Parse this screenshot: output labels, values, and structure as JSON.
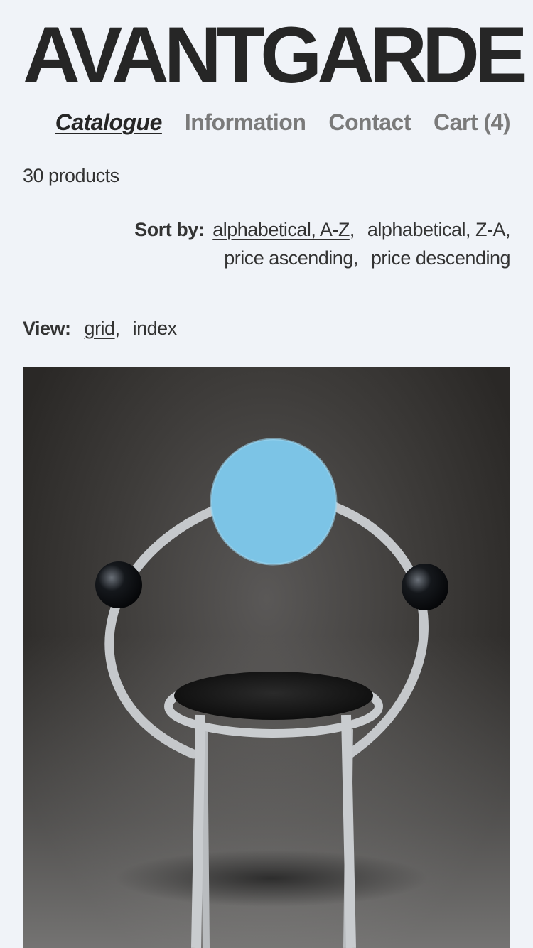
{
  "brand": {
    "logo_text": "AVANTGARDE"
  },
  "nav": {
    "items": [
      {
        "label": "Catalogue"
      },
      {
        "label": "Information"
      },
      {
        "label": "Contact"
      },
      {
        "label": "Cart (4)"
      }
    ]
  },
  "catalog": {
    "product_count": "30 products",
    "sort": {
      "label": "Sort by:",
      "options": [
        "alphabetical, A-Z",
        "alphabetical, Z-A",
        "price ascending",
        "price descending"
      ]
    },
    "view": {
      "label": "View:",
      "options": [
        "grid",
        "index"
      ]
    }
  },
  "colors": {
    "background": "#f0f3f8",
    "text_primary": "#262626",
    "text_muted": "#7a7a7a",
    "chair_back": "#7cc4e6"
  }
}
